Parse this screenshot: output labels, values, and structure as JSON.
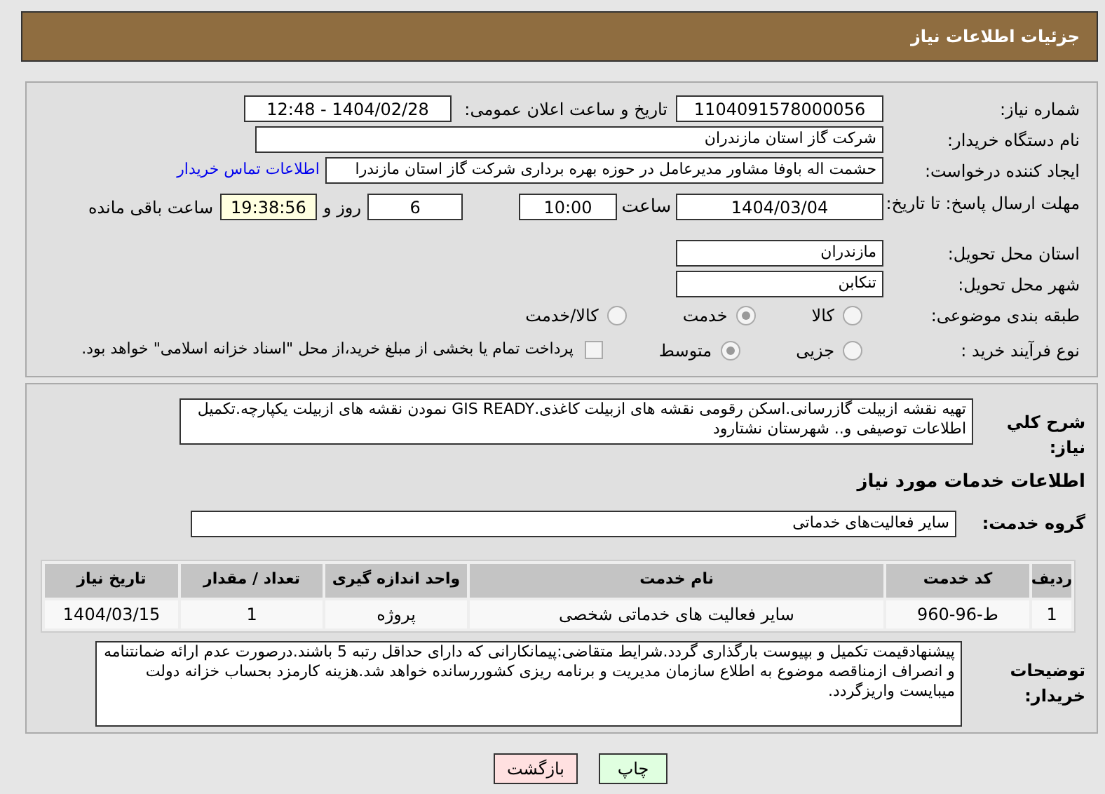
{
  "header": {
    "title": "جزئیات اطلاعات نیاز"
  },
  "details": {
    "need_number": {
      "label": "شماره نیاز:",
      "value": "1104091578000056"
    },
    "announce": {
      "label": "تاریخ و ساعت اعلان عمومی:",
      "value": "1404/02/28 - 12:48"
    },
    "buyer": {
      "label": "نام دستگاه خریدار:",
      "value": "شرکت گاز استان مازندران"
    },
    "creator": {
      "label": "ایجاد کننده درخواست:",
      "value": "حشمت اله باوفا مشاور مدیرعامل در حوزه بهره برداری  شرکت گاز استان مازندرا",
      "link": "اطلاعات تماس خریدار"
    },
    "deadline": {
      "label": "مهلت ارسال پاسخ: تا تاریخ:",
      "date": "1404/03/04",
      "time_label": "ساعت",
      "time": "10:00",
      "days": "6",
      "days_label": "روز و",
      "remaining": "19:38:56",
      "remaining_label": "ساعت باقی مانده"
    },
    "province": {
      "label": "استان محل تحویل:",
      "value": "مازندران"
    },
    "city": {
      "label": "شهر محل تحویل:",
      "value": "تنکابن"
    },
    "category": {
      "label": "طبقه بندی موضوعی:",
      "options": [
        {
          "label": "کالا",
          "selected": false
        },
        {
          "label": "خدمت",
          "selected": true
        },
        {
          "label": "کالا/خدمت",
          "selected": false
        }
      ]
    },
    "process": {
      "label": "نوع فرآیند خرید :",
      "options": [
        {
          "label": "جزیی",
          "selected": false
        },
        {
          "label": "متوسط",
          "selected": true
        }
      ],
      "payment": {
        "checked": false,
        "text": "پرداخت تمام یا بخشی از مبلغ خرید،از محل \"اسناد خزانه اسلامی\" خواهد بود."
      }
    }
  },
  "services": {
    "description": {
      "label": "شرح کلي نیاز:",
      "value": "تهیه نقشه ازبیلت گازرسانی.اسکن رقومی نقشه های ازبیلت کاغذی.GIS READY نمودن نقشه های ازبیلت یکپارچه.تکمیل اطلاعات توصیفی و.. شهرستان نشتارود"
    },
    "section_title": "اطلاعات خدمات مورد نیاز",
    "group": {
      "label": "گروه خدمت:",
      "value": "سایر فعالیت‌های خدماتی"
    },
    "table": {
      "columns": [
        "ردیف",
        "کد خدمت",
        "نام خدمت",
        "واحد اندازه گیری",
        "تعداد / مقدار",
        "تاریخ نیاز"
      ],
      "rows": [
        [
          "1",
          "ط-96-960",
          "سایر فعالیت های خدماتی شخصی",
          "پروژه",
          "1",
          "1404/03/15"
        ]
      ]
    },
    "notes": {
      "label": "توضیحات خریدار:",
      "value": "پیشنهادقیمت تکمیل و بپیوست بارگذاری گردد.شرایط متقاضی:پیمانکارانی که دارای حداقل رتبه 5 باشند.درصورت عدم ارائه ضمانتنامه و انصراف ازمناقصه موضوع به اطلاع سازمان مدیریت و برنامه ریزی کشوررسانده خواهد شد.هزینه کارمزد بحساب خزانه دولت میبایست واریزگردد."
    }
  },
  "buttons": [
    {
      "label": "چاپ",
      "kind": "print"
    },
    {
      "label": "بازگشت",
      "kind": "back"
    }
  ]
}
